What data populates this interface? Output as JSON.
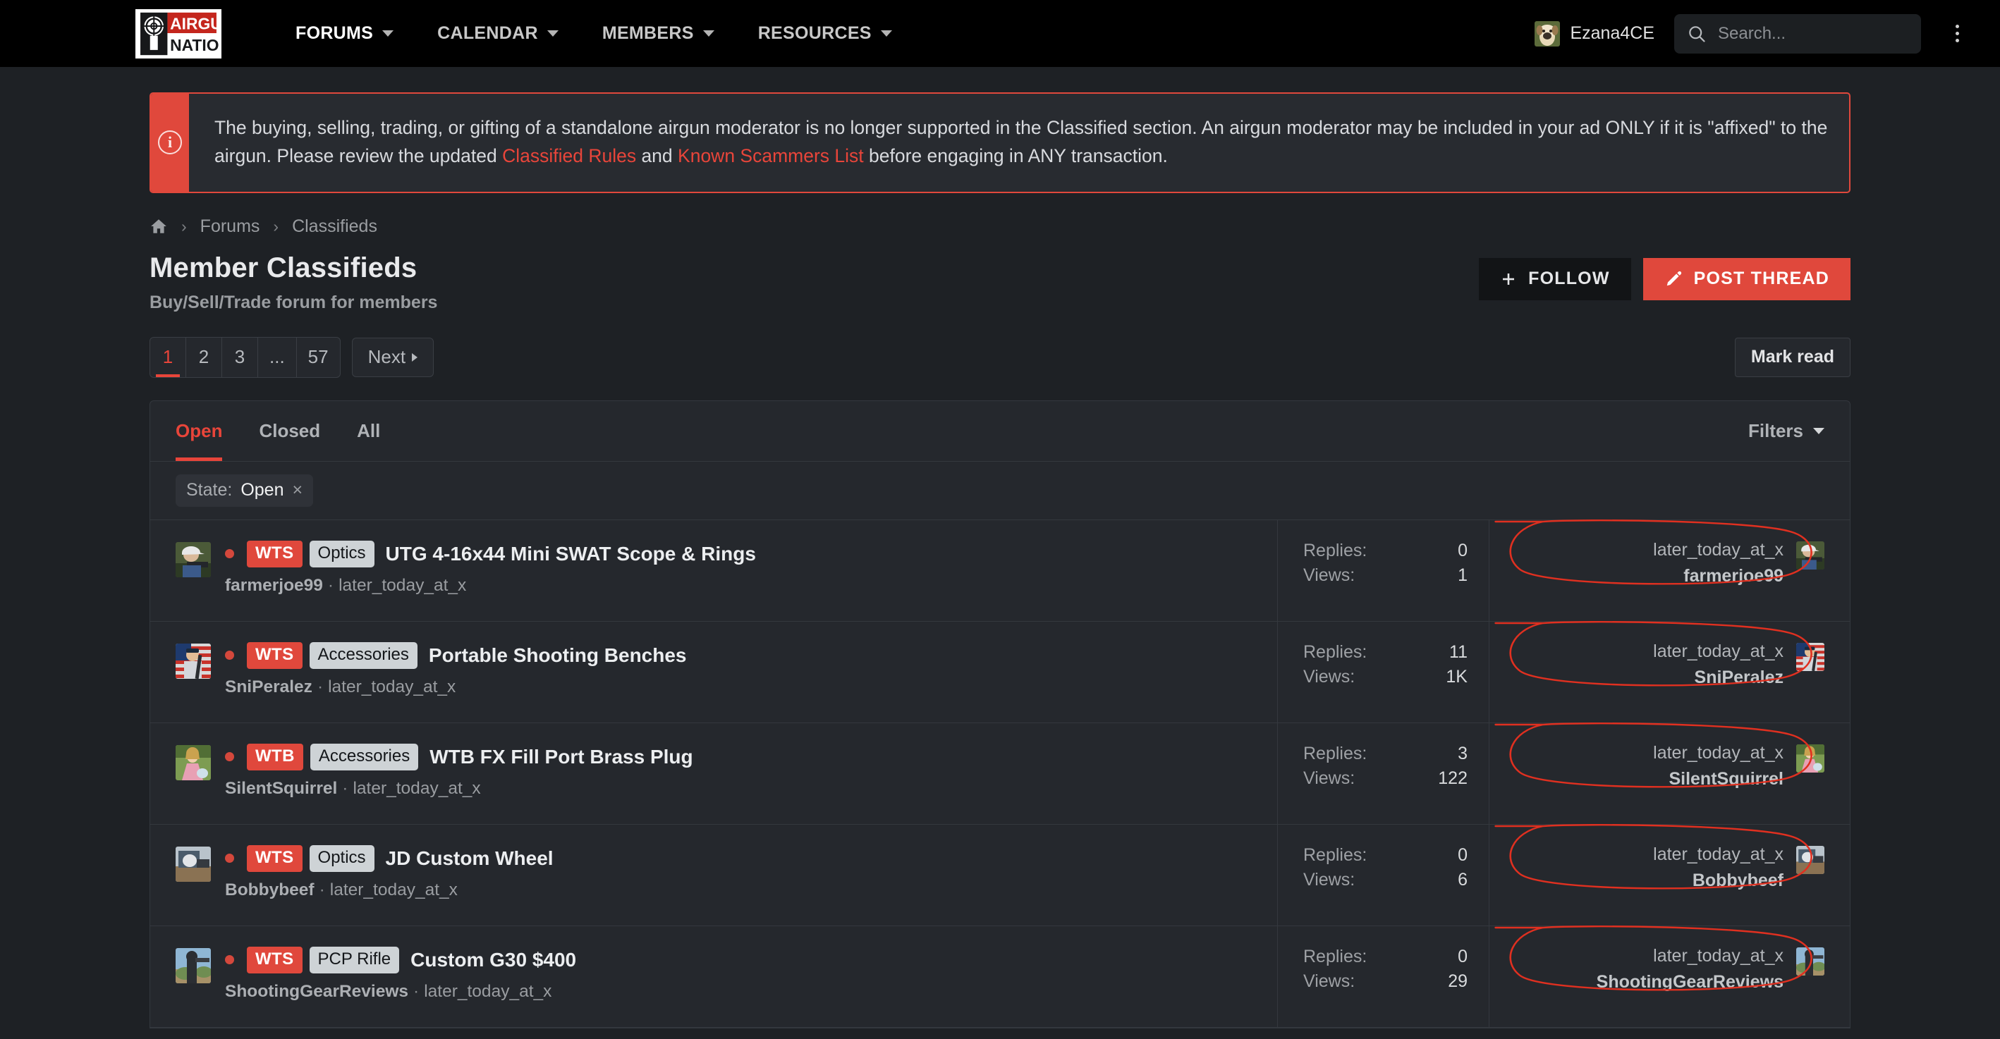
{
  "header": {
    "logo_top": "AIRGUN",
    "logo_bottom": "NATION",
    "nav": [
      {
        "label": "FORUMS",
        "has_caret": true
      },
      {
        "label": "CALENDAR",
        "has_caret": true
      },
      {
        "label": "MEMBERS",
        "has_caret": true
      },
      {
        "label": "RESOURCES",
        "has_caret": true
      }
    ],
    "user": "Ezana4CE",
    "search_placeholder": "Search...",
    "search_value": ""
  },
  "alert": {
    "part1": "The buying, selling, trading, or gifting of a standalone airgun moderator is no longer supported in the Classified section. An airgun moderator may be included in your ad ONLY if it is \"affixed\" to the airgun. Please review the updated ",
    "link1": "Classified Rules",
    "mid": " and ",
    "link2": "Known Scammers List",
    "part2": " before engaging in ANY transaction.",
    "icon": "info-icon"
  },
  "breadcrumb": {
    "home": "home-icon",
    "items": [
      "Forums",
      "Classifieds"
    ],
    "separator": "›"
  },
  "page": {
    "title": "Member Classifieds",
    "subtitle": "Buy/Sell/Trade forum for members",
    "follow_label": "FOLLOW",
    "post_label": "POST THREAD"
  },
  "pagination": {
    "pages": [
      "1",
      "2",
      "3",
      "...",
      "57"
    ],
    "active_index": 0,
    "next_label": "Next",
    "mark_read_label": "Mark read"
  },
  "tabs": [
    {
      "label": "Open",
      "active": true
    },
    {
      "label": "Closed",
      "active": false
    },
    {
      "label": "All",
      "active": false
    }
  ],
  "filters_label": "Filters",
  "chips": [
    {
      "key": "State:",
      "value": "Open",
      "remove": "×"
    }
  ],
  "stat_labels": {
    "replies": "Replies:",
    "views": "Views:"
  },
  "threads": [
    {
      "type_badge": "WTS",
      "category": "Optics",
      "title": "UTG 4-16x44 Mini SWAT Scope & Rings",
      "author": "farmerjoe99",
      "date": "later_today_at_x",
      "replies": "0",
      "views": "1",
      "last_date": "later_today_at_x",
      "last_user": "farmerjoe99",
      "avatar": "shooter-cap",
      "annotated": true
    },
    {
      "type_badge": "WTS",
      "category": "Accessories",
      "title": "Portable Shooting Benches",
      "author": "SniPeralez",
      "date": "later_today_at_x",
      "replies": "11",
      "views": "1K",
      "last_date": "later_today_at_x",
      "last_user": "SniPeralez",
      "avatar": "flag-officer",
      "annotated": true
    },
    {
      "type_badge": "WTB",
      "category": "Accessories",
      "title": "WTB FX Fill Port Brass Plug",
      "author": "SilentSquirrel",
      "date": "later_today_at_x",
      "replies": "3",
      "views": "122",
      "last_date": "later_today_at_x",
      "last_user": "SilentSquirrel",
      "avatar": "girl-garden",
      "annotated": true
    },
    {
      "type_badge": "WTS",
      "category": "Optics",
      "title": "JD Custom Wheel",
      "author": "Bobbybeef",
      "date": "later_today_at_x",
      "replies": "0",
      "views": "6",
      "last_date": "later_today_at_x",
      "last_user": "Bobbybeef",
      "avatar": "workbench",
      "annotated": true
    },
    {
      "type_badge": "WTS",
      "category": "PCP Rifle",
      "title": "Custom G30 $400",
      "author": "ShootingGearReviews",
      "date": "later_today_at_x",
      "replies": "0",
      "views": "29",
      "last_date": "later_today_at_x",
      "last_user": "ShootingGearReviews",
      "avatar": "outdoor-shooter",
      "annotated": true
    }
  ],
  "colors": {
    "accent_red": "#e0483c",
    "link_red": "#e8453a",
    "panel_bg": "#25282d",
    "page_bg": "#1e2125",
    "header_bg": "#000000",
    "annotation": "#e03020"
  }
}
